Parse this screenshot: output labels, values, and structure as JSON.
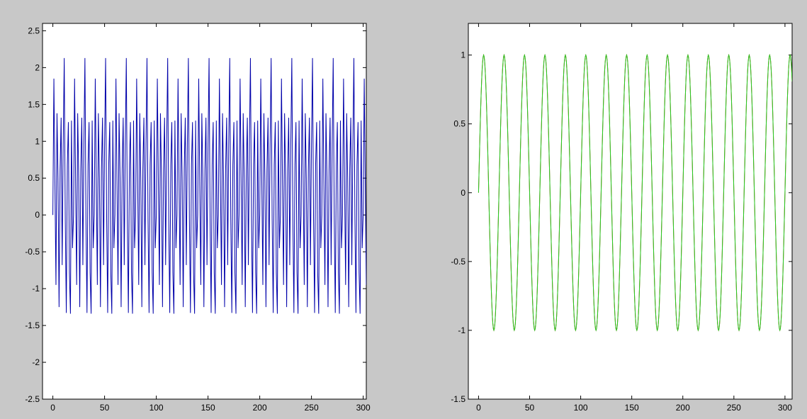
{
  "figure": {
    "background": "#c8c8c8",
    "axes_background": "#ffffff"
  },
  "chart_data": [
    {
      "type": "line",
      "title": "",
      "xlabel": "",
      "ylabel": "",
      "xlim": [
        -10,
        303
      ],
      "ylim": [
        -2.5,
        2.6
      ],
      "x_ticks": [
        0,
        50,
        100,
        150,
        200,
        250,
        300
      ],
      "x_tick_labels": [
        "0",
        "50",
        "100",
        "150",
        "200",
        "250",
        "300"
      ],
      "y_ticks": [
        -2.5,
        -2,
        -1.5,
        -1,
        -0.5,
        0,
        0.5,
        1,
        1.5,
        2,
        2.5
      ],
      "y_tick_labels": [
        "-2.5",
        "-2",
        "-1.5",
        "-1",
        "-0.5",
        "0",
        "0.5",
        "1",
        "1.5",
        "2",
        "2.5"
      ],
      "grid": false,
      "legend": "none",
      "series": [
        {
          "color": "#0000aa",
          "x_range": [
            0,
            303
          ],
          "sampling": "integer",
          "formula": "sin(2*pi*k/20)+sin(2*pi*k/5)*0.9 approx (periodic, period 20, peak 2.13, trough -2.13)",
          "y": [
            0,
            1.85,
            0.42,
            -0.95,
            1.38,
            0.5,
            -1.25,
            0.62,
            1.32,
            -0.68,
            0.95,
            2.13,
            -0.05,
            -1.33,
            0.68,
            1.26,
            -0.78,
            -1.34,
            1.28,
            -0.45
          ]
        }
      ]
    },
    {
      "type": "line",
      "title": "",
      "xlabel": "",
      "ylabel": "",
      "xlim": [
        -10,
        307
      ],
      "ylim": [
        -1.5,
        1.23
      ],
      "x_ticks": [
        0,
        50,
        100,
        150,
        200,
        250,
        300
      ],
      "x_tick_labels": [
        "0",
        "50",
        "100",
        "150",
        "200",
        "250",
        "300"
      ],
      "y_ticks": [
        -1.5,
        -1,
        -0.5,
        0,
        0.5,
        1
      ],
      "y_tick_labels": [
        "-1.5",
        "-1",
        "-0.5",
        "0",
        "0.5",
        "1"
      ],
      "grid": false,
      "legend": "none",
      "series": [
        {
          "color": "#cc2200",
          "x_range": [
            0,
            307
          ],
          "period": 20,
          "amplitude": 1
        },
        {
          "color": "#22cc22",
          "x_range": [
            0,
            307
          ],
          "period": 20,
          "amplitude": 1
        }
      ]
    }
  ]
}
